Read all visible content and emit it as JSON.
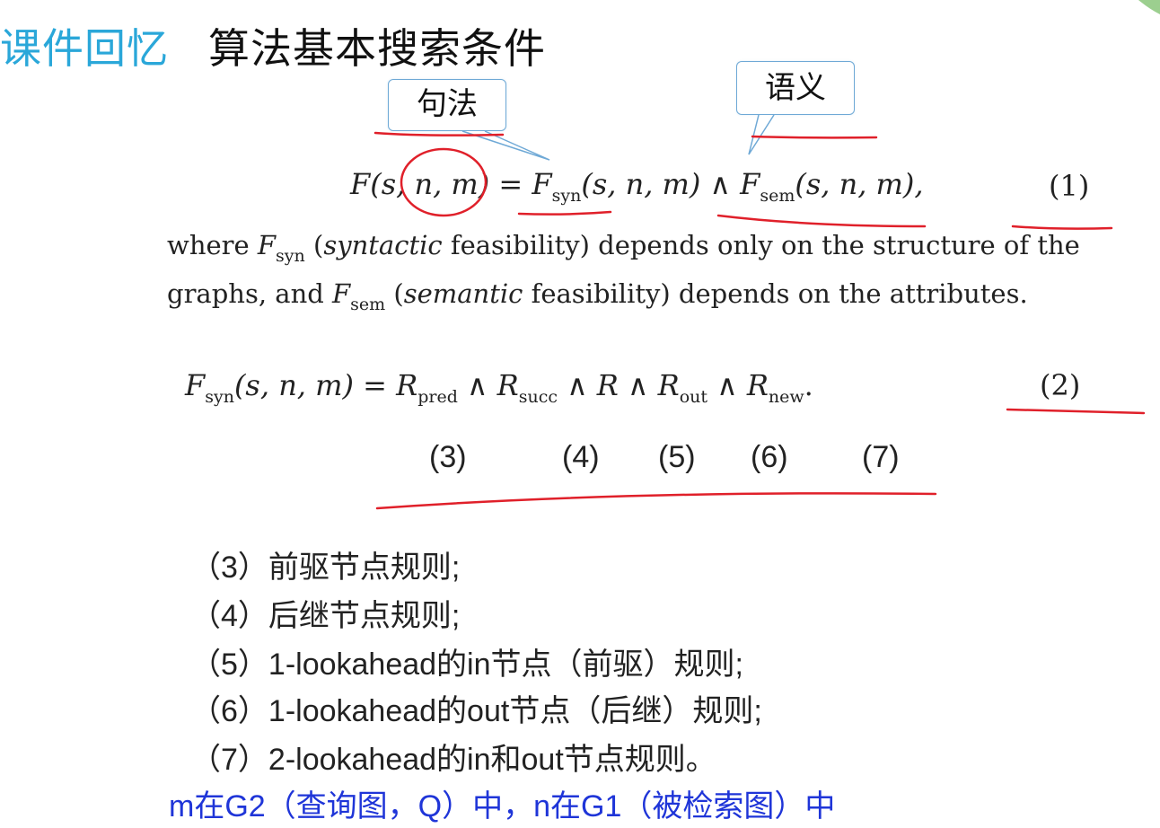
{
  "title": {
    "prefix": "课件回忆",
    "main": "算法基本搜索条件"
  },
  "callouts": {
    "syntax": "句法",
    "semantic": "语义"
  },
  "eq1": {
    "lhs_open": "F(s, ",
    "lhs_n": "n",
    "lhs_rest": ", m)",
    "eq": " = ",
    "fsyn": "F",
    "fsyn_sub": "syn",
    "fsyn_args": "(s, n, m)",
    "and": " ∧ ",
    "fsem": "F",
    "fsem_sub": "sem",
    "fsem_args": "(s, n, m),",
    "number": "(1)"
  },
  "para": {
    "w1": "where ",
    "fsyn": "F",
    "fsyn_sub": "syn",
    "p1": " (",
    "syntactic": "syntactic",
    "p2": " feasibility) depends only on the structure of the graphs, and ",
    "fsem": "F",
    "fsem_sub": "sem",
    "p3": " (",
    "semantic": "semantic",
    "p4": " feasibility) depends on the attributes."
  },
  "eq2": {
    "lhs": "F",
    "lhs_sub": "syn",
    "lhs_args": "(s, n, m) = ",
    "r": "R",
    "pred": "pred",
    "succ": "succ",
    "mid": "",
    "out": "out",
    "new": "new",
    "and": " ∧ ",
    "dot": ".",
    "number": "(2)"
  },
  "refs": [
    "(3)",
    "(4)",
    "(5)",
    "(6)",
    "(7)"
  ],
  "rules": [
    "（3）前驱节点规则;",
    "（4）后继节点规则;",
    "（5）1-lookahead的in节点（前驱）规则;",
    "（6）1-lookahead的out节点（后继）规则;",
    "（7）2-lookahead的in和out节点规则。"
  ],
  "note": "m在G2（查询图，Q）中，n在G1（被检索图）中",
  "colors": {
    "title_prefix": "#2aa7d9",
    "annotation_red": "#e0202a",
    "callout_border": "#6fa9d6",
    "note_blue": "#1f35d8"
  }
}
